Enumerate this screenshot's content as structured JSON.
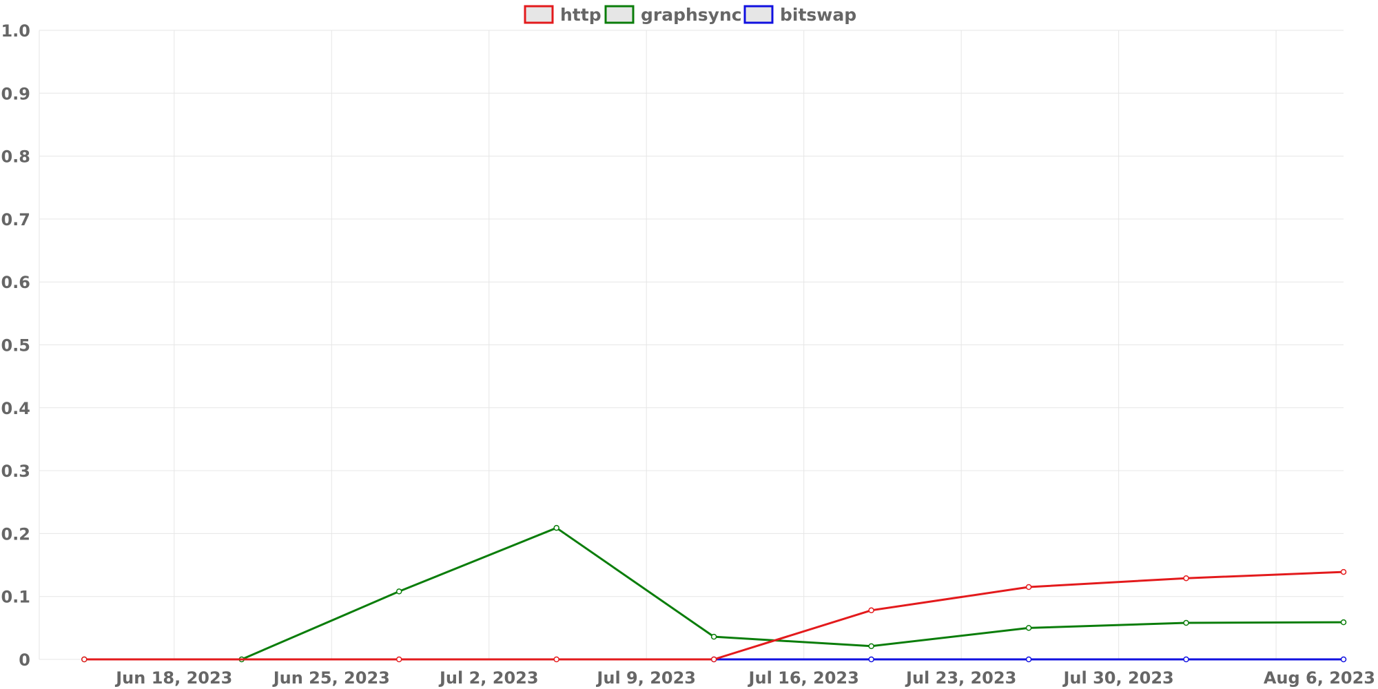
{
  "chart_data": {
    "type": "line",
    "x_type": "date",
    "x": [
      "2023-06-14",
      "2023-06-21",
      "2023-06-28",
      "2023-07-05",
      "2023-07-12",
      "2023-07-19",
      "2023-07-26",
      "2023-08-02",
      "2023-08-09"
    ],
    "xlim": [
      "2023-06-12",
      "2023-08-09"
    ],
    "x_ticks": [
      {
        "date": "2023-06-18",
        "label": "Jun 18, 2023"
      },
      {
        "date": "2023-06-25",
        "label": "Jun 25, 2023"
      },
      {
        "date": "2023-07-02",
        "label": "Jul 2, 2023"
      },
      {
        "date": "2023-07-09",
        "label": "Jul 9, 2023"
      },
      {
        "date": "2023-07-16",
        "label": "Jul 16, 2023"
      },
      {
        "date": "2023-07-23",
        "label": "Jul 23, 2023"
      },
      {
        "date": "2023-07-30",
        "label": "Jul 30, 2023"
      },
      {
        "date": "2023-08-06",
        "label": "Aug 6, 2023"
      }
    ],
    "ylim": [
      0,
      1.0
    ],
    "y_ticks": [
      {
        "value": 0,
        "label": "0"
      },
      {
        "value": 0.1,
        "label": "0.1"
      },
      {
        "value": 0.2,
        "label": "0.2"
      },
      {
        "value": 0.3,
        "label": "0.3"
      },
      {
        "value": 0.4,
        "label": "0.4"
      },
      {
        "value": 0.5,
        "label": "0.5"
      },
      {
        "value": 0.6,
        "label": "0.6"
      },
      {
        "value": 0.7,
        "label": "0.7"
      },
      {
        "value": 0.8,
        "label": "0.8"
      },
      {
        "value": 0.9,
        "label": "0.9"
      },
      {
        "value": 1.0,
        "label": "1.0"
      }
    ],
    "grid": true,
    "legend_position": "top-center",
    "title": "",
    "xlabel": "",
    "ylabel": "",
    "series": [
      {
        "name": "http",
        "color": "#e31a1c",
        "values": [
          0,
          null,
          0,
          0,
          0,
          0.078,
          0.115,
          0.129,
          0.139
        ]
      },
      {
        "name": "graphsync",
        "color": "#0a7d0a",
        "values": [
          0,
          0,
          0.108,
          0.209,
          0.036,
          0.021,
          0.05,
          0.058,
          0.059
        ]
      },
      {
        "name": "bitswap",
        "color": "#1010e0",
        "values": [
          null,
          null,
          null,
          null,
          0,
          0,
          0,
          0,
          0
        ]
      }
    ]
  }
}
